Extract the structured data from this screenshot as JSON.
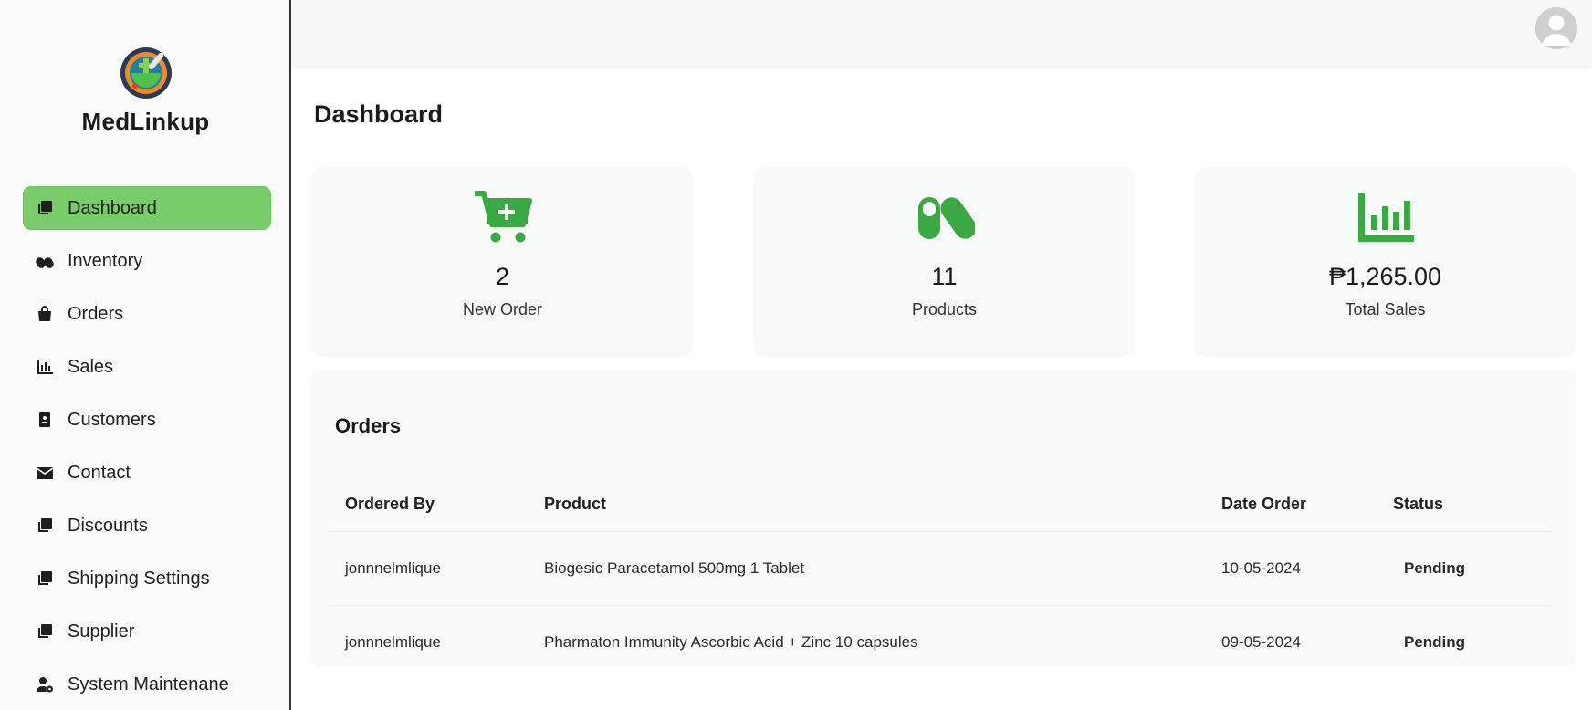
{
  "brand": {
    "name": "MedLinkup"
  },
  "sidebar": {
    "items": [
      {
        "label": "Dashboard",
        "icon": "copy-icon",
        "active": true
      },
      {
        "label": "Inventory",
        "icon": "pills-icon"
      },
      {
        "label": "Orders",
        "icon": "shopping-bag-icon"
      },
      {
        "label": "Sales",
        "icon": "bar-chart-icon"
      },
      {
        "label": "Customers",
        "icon": "contact-card-icon"
      },
      {
        "label": "Contact",
        "icon": "envelope-icon"
      },
      {
        "label": "Discounts",
        "icon": "copy-icon"
      },
      {
        "label": "Shipping Settings",
        "icon": "copy-icon"
      },
      {
        "label": "Supplier",
        "icon": "copy-icon"
      },
      {
        "label": "System Maintenane",
        "icon": "user-gear-icon"
      }
    ]
  },
  "header": {
    "avatar_icon": "user-avatar-icon"
  },
  "page": {
    "title": "Dashboard"
  },
  "cards": [
    {
      "icon": "cart-plus-icon",
      "value": "2",
      "label": "New Order"
    },
    {
      "icon": "pills-icon",
      "value": "11",
      "label": "Products"
    },
    {
      "icon": "bar-chart-icon",
      "value": "₱1,265.00",
      "label": "Total Sales"
    }
  ],
  "orders": {
    "title": "Orders",
    "columns": [
      "Ordered By",
      "Product",
      "Date Order",
      "Status"
    ],
    "rows": [
      [
        "jonnnelmlique",
        "Biogesic Paracetamol 500mg 1 Tablet",
        "10-05-2024",
        "Pending"
      ],
      [
        "jonnnelmlique",
        "Pharmaton Immunity Ascorbic Acid + Zinc 10 capsules",
        "09-05-2024",
        "Pending"
      ]
    ]
  },
  "colors": {
    "accent": "#78cc6a",
    "icon_green": "#3aa843"
  }
}
